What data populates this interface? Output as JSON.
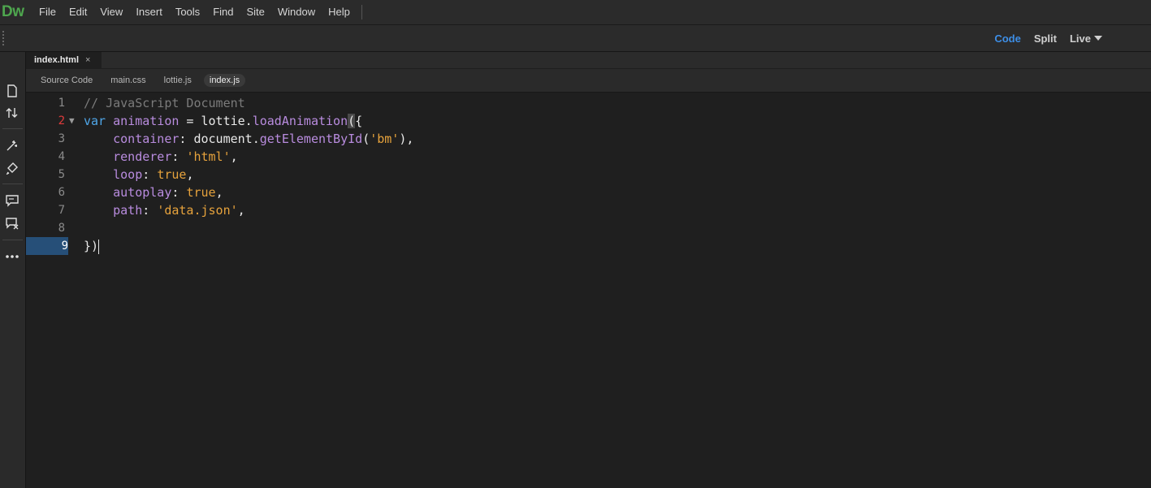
{
  "app": {
    "logo": "Dw"
  },
  "menu": [
    "File",
    "Edit",
    "View",
    "Insert",
    "Tools",
    "Find",
    "Site",
    "Window",
    "Help"
  ],
  "view_switch": {
    "code": "Code",
    "split": "Split",
    "live": "Live",
    "active": "Code"
  },
  "doc_tab": {
    "label": "index.html",
    "close": "×"
  },
  "related_files": [
    "Source Code",
    "main.css",
    "lottie.js",
    "index.js"
  ],
  "active_related": "index.js",
  "left_tools": [
    "file-icon",
    "sort-arrows-icon",
    "wand-icon",
    "brush-icon",
    "comment-icon",
    "comment-remove-icon",
    "more-icon"
  ],
  "editor": {
    "current_line": 9,
    "error_line": 2,
    "lines": [
      {
        "n": "1",
        "tokens": [
          [
            "comment",
            "// JavaScript Document"
          ]
        ]
      },
      {
        "n": "2",
        "tokens": [
          [
            "kw",
            "var"
          ],
          [
            "plain",
            " "
          ],
          [
            "var",
            "animation"
          ],
          [
            "plain",
            " = lottie."
          ],
          [
            "fn",
            "loadAnimation"
          ],
          [
            "brace",
            "("
          ],
          [
            "plain",
            "{"
          ]
        ]
      },
      {
        "n": "3",
        "tokens": [
          [
            "plain",
            "    "
          ],
          [
            "var",
            "container"
          ],
          [
            "plain",
            ": document."
          ],
          [
            "fn",
            "getElementById"
          ],
          [
            "plain",
            "("
          ],
          [
            "str",
            "'bm'"
          ],
          [
            "plain",
            "),"
          ]
        ]
      },
      {
        "n": "4",
        "tokens": [
          [
            "plain",
            "    "
          ],
          [
            "var",
            "renderer"
          ],
          [
            "plain",
            ": "
          ],
          [
            "str",
            "'html'"
          ],
          [
            "plain",
            ","
          ]
        ]
      },
      {
        "n": "5",
        "tokens": [
          [
            "plain",
            "    "
          ],
          [
            "var",
            "loop"
          ],
          [
            "plain",
            ": "
          ],
          [
            "bool",
            "true"
          ],
          [
            "plain",
            ","
          ]
        ]
      },
      {
        "n": "6",
        "tokens": [
          [
            "plain",
            "    "
          ],
          [
            "var",
            "autoplay"
          ],
          [
            "plain",
            ": "
          ],
          [
            "bool",
            "true"
          ],
          [
            "plain",
            ","
          ]
        ]
      },
      {
        "n": "7",
        "tokens": [
          [
            "plain",
            "    "
          ],
          [
            "var",
            "path"
          ],
          [
            "plain",
            ": "
          ],
          [
            "str",
            "'data.json'"
          ],
          [
            "plain",
            ","
          ]
        ]
      },
      {
        "n": "8",
        "tokens": []
      },
      {
        "n": "9",
        "tokens": [
          [
            "plain",
            "})"
          ]
        ]
      }
    ]
  }
}
